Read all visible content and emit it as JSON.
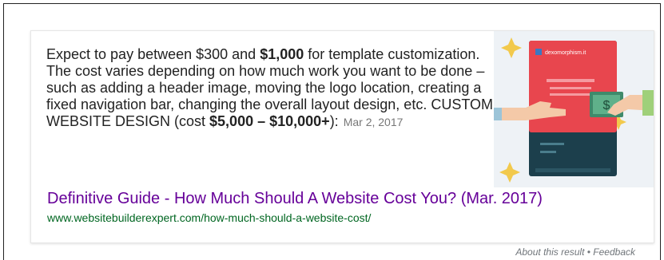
{
  "snippet": {
    "t1": "Expect to pay between $300 and ",
    "b1": "$1,000",
    "t2": " for template customization. The cost varies depending on how much work you want to be done – such as adding a header image, moving the logo location, creating a fixed navigation bar, changing the overall layout design, etc. CUSTOM WEBSITE DESIGN (cost ",
    "b2": "$5,000 – $10,000+",
    "t3": "):",
    "date": "Mar 2, 2017"
  },
  "result": {
    "title": "Definitive Guide - How Much Should A Website Cost You? (Mar. 2017)",
    "url": "www.websitebuilderexpert.com/how-much-should-a-website-cost/"
  },
  "thumbnail": {
    "site_label": "dexomorphism.it",
    "price_symbol": "$"
  },
  "footer": {
    "about": "About this result",
    "separator": " • ",
    "feedback": "Feedback"
  },
  "colors": {
    "title_link": "#660099",
    "url": "#006621",
    "thumb_bg": "#eef2f6",
    "card_red": "#e8464e",
    "card_teal": "#1c3f4c",
    "money_green": "#3f8a6b"
  }
}
